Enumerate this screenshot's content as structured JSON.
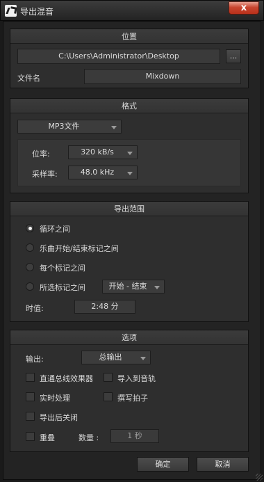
{
  "window": {
    "title": "导出混音",
    "close_label": "x"
  },
  "location": {
    "header": "位置",
    "path": "C:\\Users\\Administrator\\Desktop",
    "browse_label": "...",
    "filename_label": "文件名",
    "filename_value": "Mixdown"
  },
  "format": {
    "header": "格式",
    "type": "MP3文件",
    "bitrate_label": "位率:",
    "bitrate_value": "320 kB/s",
    "samplerate_label": "采样率:",
    "samplerate_value": "48.0 kHz"
  },
  "range": {
    "header": "导出范围",
    "options": [
      "循环之间",
      "乐曲开始/结束标记之间",
      "每个标记之间",
      "所选标记之间"
    ],
    "selected_index": 0,
    "marker_select": "开始 - 结束",
    "duration_label": "时值:",
    "duration_value": "2:48 分"
  },
  "options": {
    "header": "选项",
    "output_label": "输出:",
    "output_value": "总输出",
    "checks": {
      "direct_bus_fx": "直通总线效果器",
      "import_track": "导入到音轨",
      "realtime": "实时处理",
      "write_tempo": "撰写拍子",
      "close_after": "导出后关闭",
      "overlap": "重叠"
    },
    "count_label": "数量 :",
    "count_value": "1 秒"
  },
  "footer": {
    "ok": "确定",
    "cancel": "取消"
  }
}
